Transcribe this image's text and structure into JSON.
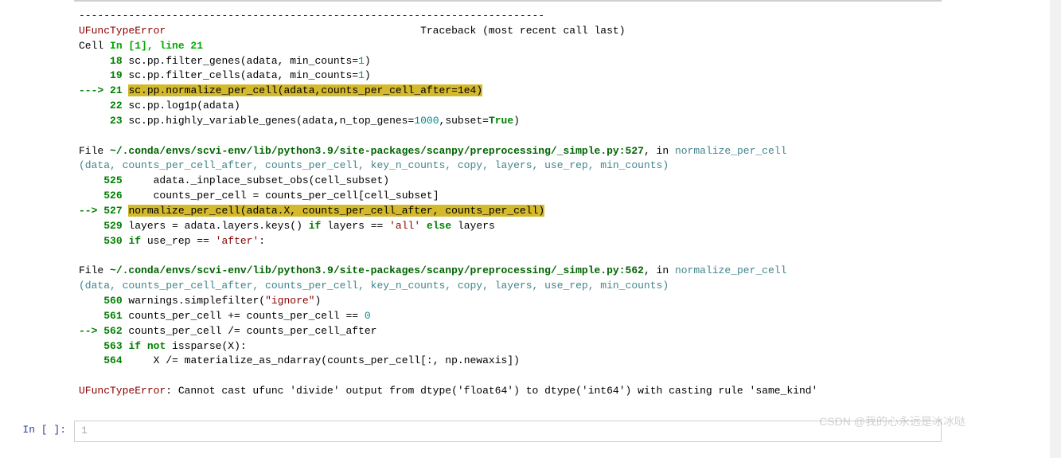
{
  "dashes": "---------------------------------------------------------------------------",
  "error_name": "UFuncTypeError",
  "traceback_header": "                                         Traceback (most recent call last)",
  "cell_label": "Cell ",
  "cell_in": "In [1], line 21",
  "lines": {
    "l18_num": "18",
    "l18": " sc.pp.filter_genes(adata, min_counts",
    "l18_eq": "=",
    "l18_v": "1",
    "l18_end": ")",
    "l19_num": "19",
    "l19": " sc.pp.filter_cells(adata, min_counts",
    "l19_v": "1",
    "l21_arrow": "---> ",
    "l21_num": "21",
    "l21_hl1": "sc",
    "l21_dot": ".",
    "l21_hl2": "pp",
    "l21_hl3": "normalize_per_cell(adata,counts_per_cell_after",
    "l21_eq": "=",
    "l21_hl4": "1e4",
    "l21_hl5": ")",
    "l22_num": "22",
    "l22": " sc.pp.log1p(adata)",
    "l23_num": "23",
    "l23": " sc.pp.highly_variable_genes(adata,n_top_genes",
    "l23_v": "1000",
    "l23_mid": ",subset",
    "l23_true": "True",
    "l23_end": ")"
  },
  "file1_label": "File ",
  "file1_path": "~/.conda/envs/scvi-env/lib/python3.9/site-packages/scanpy/preprocessing/_simple.py:527",
  "in_label": ", in ",
  "func_sig": "normalize_per_cell",
  "func_sig2": "(data, counts_per_cell_after, counts_per_cell, key_n_counts, copy, layers, use_rep, min_counts)",
  "s525_num": "525",
  "s525": "     adata._inplace_subset_obs(cell_subset)",
  "s526_num": "526",
  "s526": "     counts_per_cell ",
  "s526_eq": "=",
  "s526_rest": " counts_per_cell[cell_subset]",
  "s527_arrow": "--> ",
  "s527_num": "527",
  "s527_hl": "normalize_per_cell(adata",
  "s527_hl2": "X, counts_per_cell_after, counts_per_cell)",
  "s529_num": "529",
  "s529": " layers ",
  "s529_rest": " adata.layers.keys() ",
  "s529_if": "if",
  "s529_mid": " layers ",
  "s529_eq2": "==",
  "s529_str": " 'all' ",
  "s529_else": "else",
  "s529_end": " layers",
  "s530_num": "530",
  "s530_if": "if",
  "s530": " use_rep ",
  "s530_eq": "==",
  "s530_str": " 'after'",
  "s530_col": ":",
  "file2_path": "~/.conda/envs/scvi-env/lib/python3.9/site-packages/scanpy/preprocessing/_simple.py:562",
  "s560_num": "560",
  "s560": " warnings.simplefilter(",
  "s560_str": "\"ignore\"",
  "s560_end": ")",
  "s561_num": "561",
  "s561": " counts_per_cell ",
  "s561_op": "+=",
  "s561_rest": " counts_per_cell ",
  "s561_eq": "==",
  "s561_0": " 0",
  "s562_arrow": "--> ",
  "s562_num": "562",
  "s562": " counts_per_cell ",
  "s562_op": "/=",
  "s562_rest": " counts_per_cell_after",
  "s563_num": "563",
  "s563_if": "if",
  "s563_not": " not",
  "s563": " issparse(X):",
  "s564_num": "564",
  "s564": "     X ",
  "s564_op": "/=",
  "s564_rest": " materialize_as_ndarray(counts_per_cell[:, np.newaxis])",
  "final_err": "UFuncTypeError",
  "final_msg": ": Cannot cast ufunc 'divide' output from dtype('float64') to dtype('int64') with casting rule 'same_kind'",
  "next_prompt": "In [ ]:",
  "next_line": "1",
  "watermark": "CSDN @我的心永远是冰冰哒"
}
